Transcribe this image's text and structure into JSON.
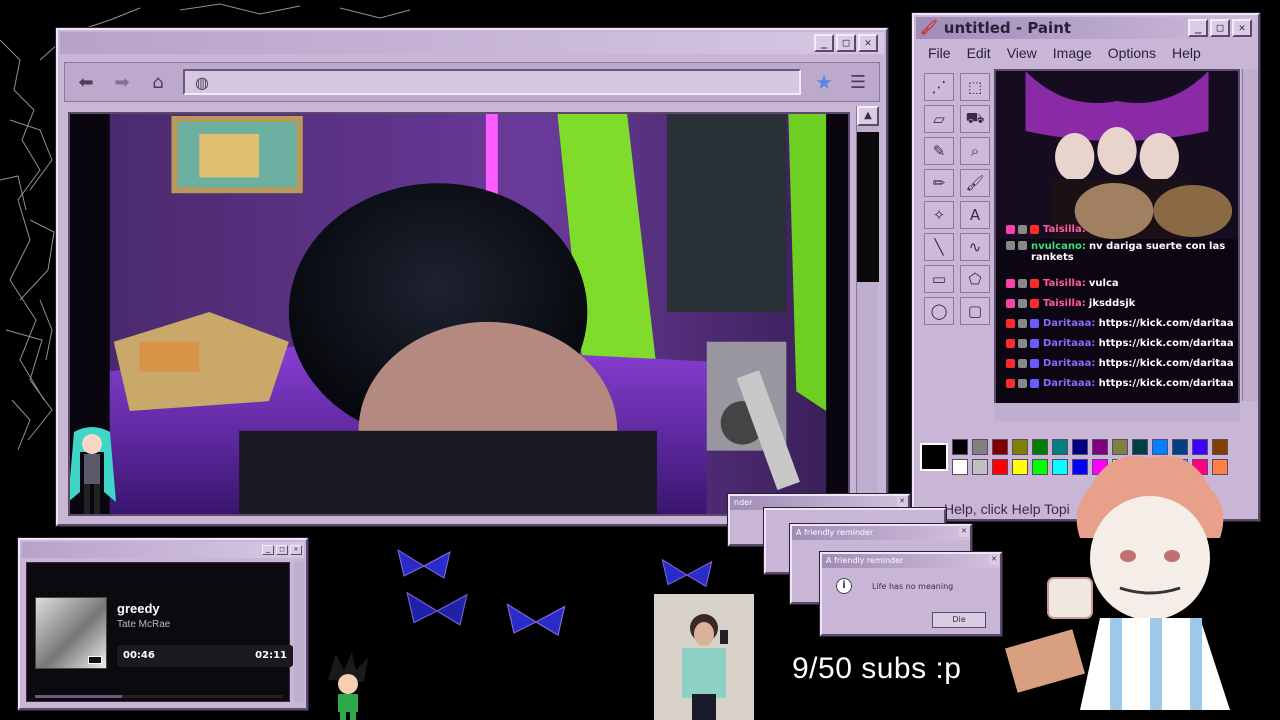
{
  "browser": {
    "nav": {
      "back_icon": "arrow-left-icon",
      "forward_icon": "arrow-right-icon",
      "home_icon": "home-icon",
      "globe_icon": "globe-icon",
      "bookmark_icon": "star-icon",
      "menu_icon": "hamburger-icon"
    },
    "controls": [
      "_",
      "□",
      "✕"
    ]
  },
  "paint": {
    "title": "untitled - Paint",
    "menu": [
      "File",
      "Edit",
      "View",
      "Image",
      "Options",
      "Help"
    ],
    "status": "Help, click Help Topi",
    "controls": [
      "_",
      "□",
      "✕"
    ],
    "tools": [
      "free-select-icon",
      "rect-select-icon",
      "eraser-icon",
      "fill-icon",
      "picker-icon",
      "magnifier-icon",
      "pencil-icon",
      "brush-icon",
      "airbrush-icon",
      "text-icon",
      "line-icon",
      "curve-icon",
      "rectangle-icon",
      "polygon-icon",
      "ellipse-icon",
      "rounded-rect-icon"
    ],
    "tool_glyphs": [
      "⋰",
      "⬚",
      "▱",
      "⛟",
      "✎",
      "⌕",
      "✏",
      "🖌",
      "✧",
      "A",
      "╲",
      "∿",
      "▭",
      "⬠",
      "◯",
      "▢"
    ],
    "palette": [
      "#000000",
      "#808080",
      "#800000",
      "#808000",
      "#008000",
      "#008080",
      "#000080",
      "#800080",
      "#808040",
      "#004040",
      "#0080ff",
      "#004080",
      "#4000ff",
      "#804000",
      "#ffffff",
      "#c0c0c0",
      "#ff0000",
      "#ffff00",
      "#00ff00",
      "#00ffff",
      "#0000ff",
      "#ff00ff",
      "#ffff80",
      "#00ff80",
      "#80ffff",
      "#8080ff",
      "#ff0080",
      "#ff8040"
    ],
    "chat": [
      {
        "user": "Taisilla:",
        "color": "pink",
        "message": ""
      },
      {
        "user": "nvulcano:",
        "color": "green",
        "message": "nv dariga suerte con las rankets"
      },
      {
        "user": "Taisilla:",
        "color": "pink",
        "message": "vulca"
      },
      {
        "user": "Taisilla:",
        "color": "pink",
        "message": "jksddsjk"
      },
      {
        "user": "Daritaaa:",
        "color": "purple",
        "message": "https://kick.com/daritaa"
      },
      {
        "user": "Daritaaa:",
        "color": "purple",
        "message": "https://kick.com/daritaa"
      },
      {
        "user": "Daritaaa:",
        "color": "purple",
        "message": "https://kick.com/daritaa"
      },
      {
        "user": "Daritaaa:",
        "color": "purple",
        "message": "https://kick.com/daritaa"
      }
    ]
  },
  "player": {
    "song": "greedy",
    "artist": "Tate McRae",
    "current_time": "00:46",
    "total_time": "02:11",
    "progress": 0.35,
    "explicit": "PARENTAL ADVISORY"
  },
  "reminders": [
    {
      "title": "A friendly reminder",
      "text": "Life has no meaning",
      "button": "Die"
    },
    {
      "title": "A friendly reminder"
    },
    {
      "title": "nder"
    }
  ],
  "subs_text": "9/50 subs :p",
  "colors": {
    "window_bg": "#c9b6d6",
    "accent_pink": "#ff5aa5",
    "accent_green": "#39e07a",
    "accent_purple": "#8b6bff"
  }
}
